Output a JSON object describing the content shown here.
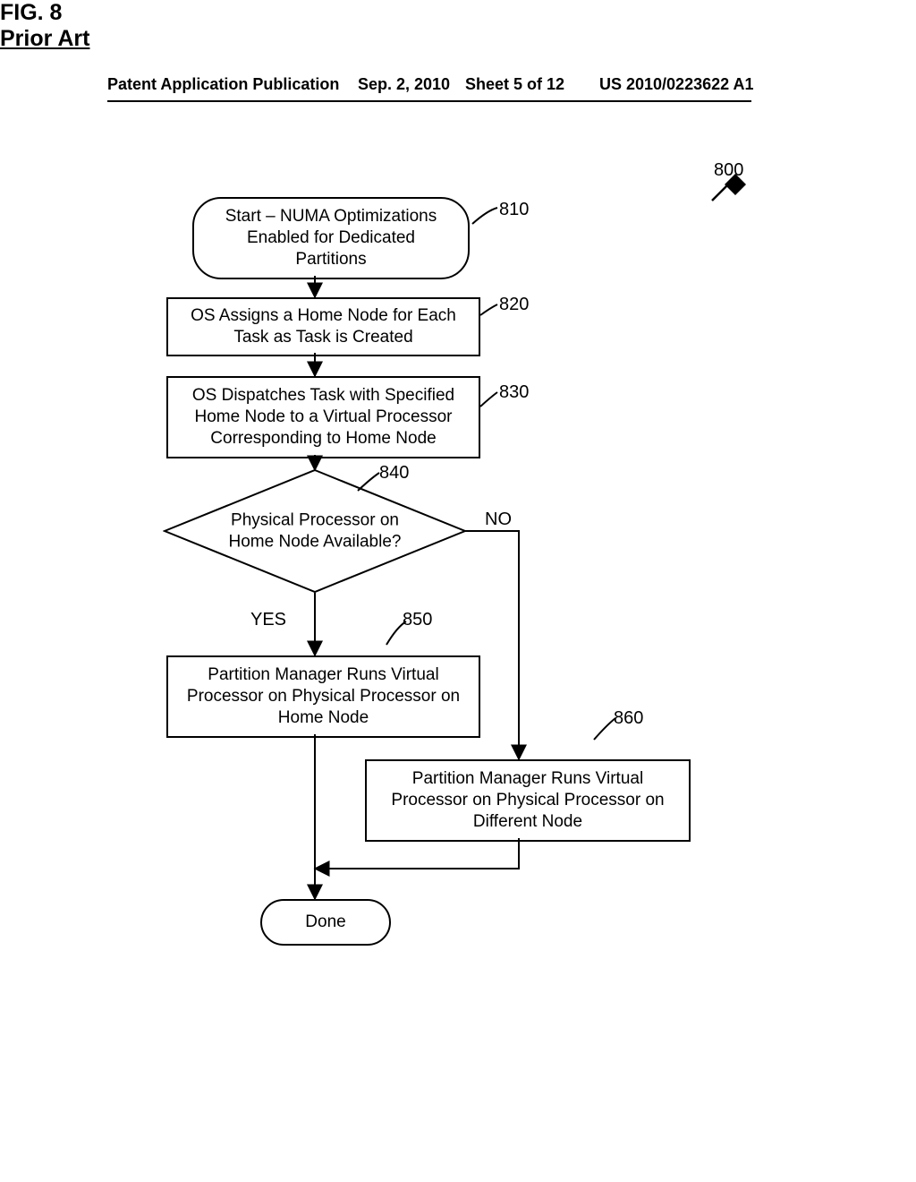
{
  "header": {
    "left": "Patent Application Publication",
    "center": "Sep. 2, 2010",
    "sheet": "Sheet 5 of 12",
    "right": "US 2010/0223622 A1"
  },
  "labels": {
    "ref800": "800",
    "ref810": "810",
    "ref820": "820",
    "ref830": "830",
    "ref840": "840",
    "ref850": "850",
    "ref860": "860",
    "yes": "YES",
    "no": "NO"
  },
  "nodes": {
    "start": "Start – NUMA Optimizations Enabled for Dedicated Partitions",
    "s820": "OS Assigns a Home Node for Each Task as Task is Created",
    "s830": "OS Dispatches Task with Specified Home Node to a Virtual Processor Corresponding to Home Node",
    "s840": "Physical Processor on Home Node Available?",
    "s850": "Partition Manager Runs Virtual Processor on Physical Processor on Home Node",
    "s860": "Partition Manager Runs Virtual Processor on Physical Processor on Different Node",
    "done": "Done"
  },
  "caption": {
    "fig": "FIG. 8",
    "prior": "Prior Art"
  }
}
